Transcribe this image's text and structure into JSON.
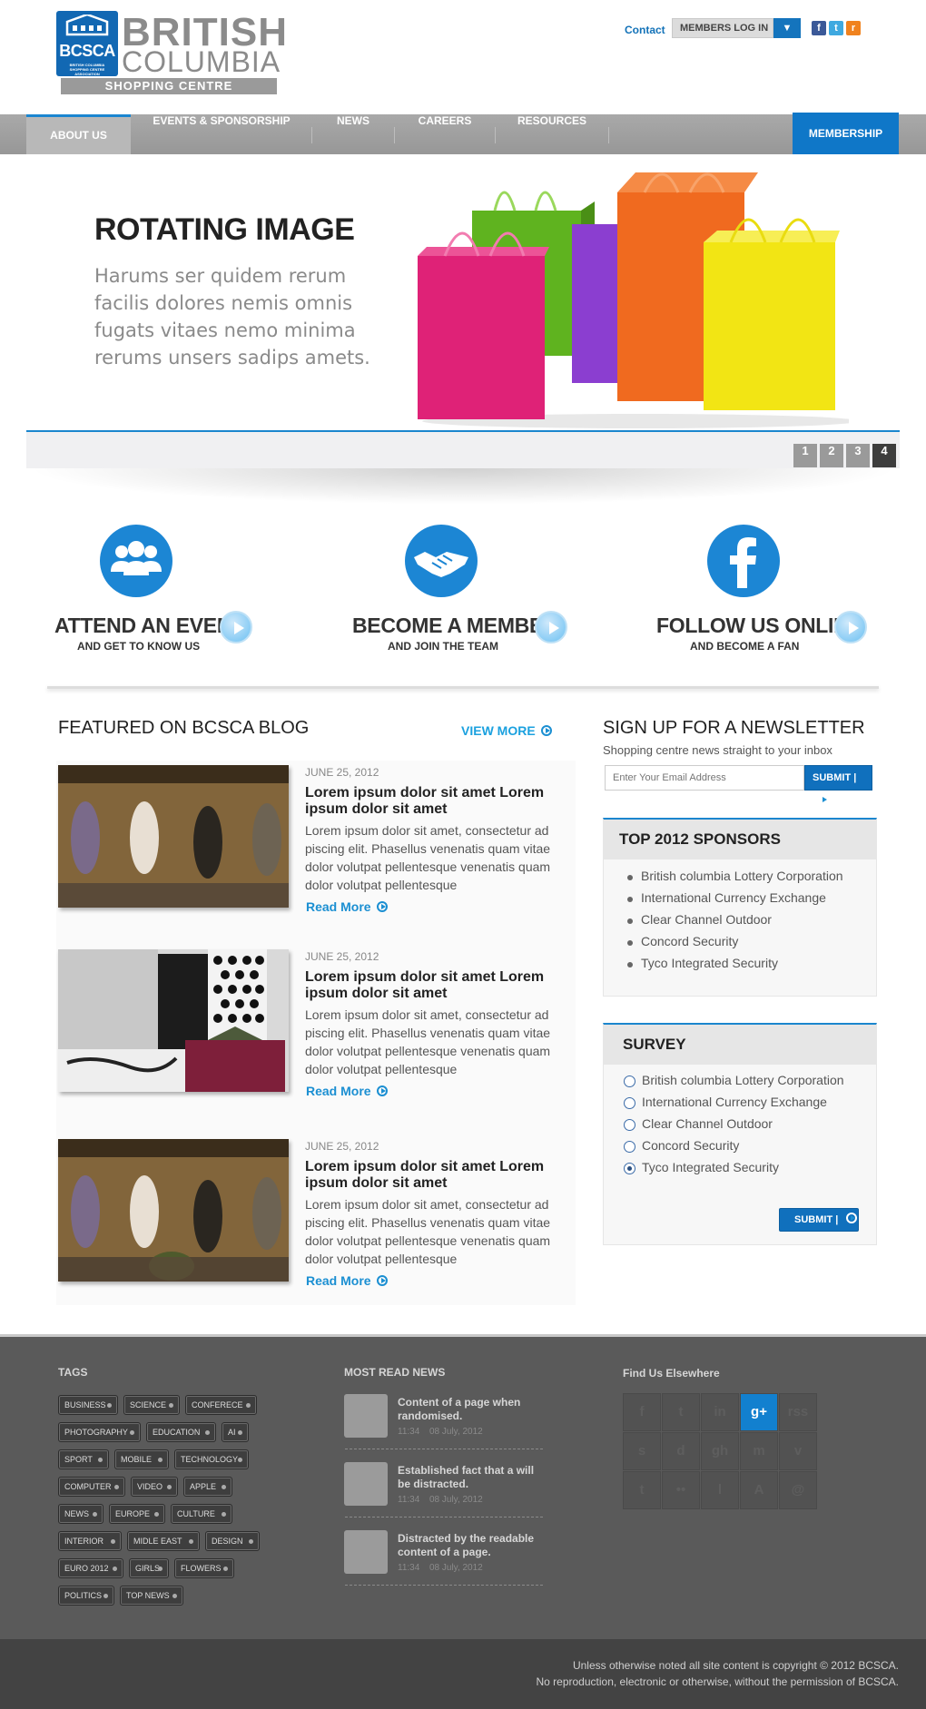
{
  "header": {
    "logo_abbr": "BCSCA",
    "logo_tiny": "BRITISH COLUMBIA SHOPPING CENTRE ASSOCIATION",
    "logo_line1": "BRITISH",
    "logo_line2": "COLUMBIA",
    "logo_tagline": "SHOPPING CENTRE ASSOCIATION",
    "contact": "Contact",
    "members_login": "MEMBERS LOG IN",
    "social": [
      {
        "icon": "facebook-icon",
        "glyph": "f",
        "color": "#3b5998"
      },
      {
        "icon": "twitter-icon",
        "glyph": "t",
        "color": "#3fa9e0"
      },
      {
        "icon": "rss-icon",
        "glyph": "r",
        "color": "#f0821e"
      }
    ]
  },
  "nav": {
    "items": [
      "ABOUT US",
      "EVENTS & SPONSORSHIP",
      "NEWS",
      "CAREERS",
      "RESOURCES"
    ],
    "membership": "MEMBERSHIP"
  },
  "hero": {
    "title": "ROTATING IMAGE",
    "text": "Harums ser quidem rerum facilis dolores nemis omnis fugats vitaes nemo minima rerums unsers sadips amets.",
    "pages": [
      "1",
      "2",
      "3",
      "4"
    ],
    "active_page": "4",
    "bag_colors": [
      "#e0237a",
      "#6cc22a",
      "#8a3fc8",
      "#f06a1f",
      "#f2e514"
    ]
  },
  "features": [
    {
      "icon": "people-icon",
      "title": "ATTEND AN EVENT",
      "subtitle": "AND GET TO KNOW US"
    },
    {
      "icon": "handshake-icon",
      "title": "BECOME A MEMBER",
      "subtitle": "AND JOIN THE TEAM"
    },
    {
      "icon": "facebook-icon",
      "title": "FOLLOW US ONLINE",
      "subtitle": "AND BECOME A FAN"
    }
  ],
  "blog": {
    "heading": "FEATURED ON BCSCA BLOG",
    "view_more": "VIEW MORE",
    "posts": [
      {
        "date": "JUNE 25, 2012",
        "title": "Lorem ipsum dolor sit amet Lorem ipsum dolor sit amet",
        "body": "Lorem ipsum dolor sit amet, consectetur ad piscing elit. Phasellus venenatis quam vitae dolor volutpat pellentesque venenatis quam dolor volutpat pellentesque",
        "read_more": "Read More"
      },
      {
        "date": "JUNE 25, 2012",
        "title": "Lorem ipsum dolor sit amet Lorem ipsum dolor sit amet",
        "body": "Lorem ipsum dolor sit amet, consectetur ad piscing elit. Phasellus venenatis quam vitae dolor volutpat pellentesque venenatis quam dolor volutpat pellentesque",
        "read_more": "Read More"
      },
      {
        "date": "JUNE 25, 2012",
        "title": "Lorem ipsum dolor sit amet Lorem ipsum dolor sit amet",
        "body": "Lorem ipsum dolor sit amet, consectetur ad piscing elit. Phasellus venenatis quam vitae dolor volutpat pellentesque venenatis quam dolor volutpat pellentesque",
        "read_more": "Read More"
      }
    ]
  },
  "newsletter": {
    "heading": "SIGN UP FOR A NEWSLETTER",
    "subtitle": "Shopping centre news straight to your inbox",
    "placeholder": "Enter Your Email Address",
    "submit": "SUBMIT"
  },
  "sponsors": {
    "heading": "TOP 2012 SPONSORS",
    "items": [
      "British columbia Lottery Corporation",
      "International Currency Exchange",
      "Clear Channel Outdoor",
      "Concord Security",
      "Tyco Integrated Security"
    ]
  },
  "survey": {
    "heading": "SURVEY",
    "options": [
      "British columbia Lottery Corporation",
      "International Currency Exchange",
      "Clear Channel Outdoor",
      "Concord Security",
      "Tyco Integrated Security"
    ],
    "selected": "Tyco Integrated Security",
    "submit": "SUBMIT"
  },
  "footer": {
    "tags_heading": "TAGS",
    "tags": [
      [
        "BUSINESS",
        "SCIENCE",
        "CONFERECE"
      ],
      [
        "PHOTOGRAPHY",
        "EDUCATION",
        "AI"
      ],
      [
        "SPORT",
        "MOBILE",
        "TECHNOLOGY"
      ],
      [
        "COMPUTER",
        "VIDEO",
        "APPLE"
      ],
      [
        "NEWS",
        "EUROPE",
        "CULTURE"
      ],
      [
        "INTERIOR",
        "MIDLE EAST",
        "DESIGN"
      ],
      [
        "EURO 2012",
        "GIRLS",
        "FLOWERS"
      ],
      [
        "POLITICS",
        "TOP NEWS"
      ]
    ],
    "news_heading": "MOST READ NEWS",
    "news": [
      {
        "title": "Content of a page when randomised.",
        "time": "11:34",
        "date": "08 July, 2012"
      },
      {
        "title": "Established fact that a will be distracted.",
        "time": "11:34",
        "date": "08 July, 2012"
      },
      {
        "title": "Distracted by the readable content of a page.",
        "time": "11:34",
        "date": "08 July, 2012"
      }
    ],
    "elsewhere_heading": "Find Us Elsewhere",
    "elsewhere_icons": [
      {
        "icon": "facebook-icon",
        "glyph": "f"
      },
      {
        "icon": "twitter-icon",
        "glyph": "t"
      },
      {
        "icon": "linkedin-icon",
        "glyph": "in"
      },
      {
        "icon": "google-plus-icon",
        "glyph": "g+"
      },
      {
        "icon": "rss-icon",
        "glyph": "rss"
      },
      {
        "icon": "skype-icon",
        "glyph": "s"
      },
      {
        "icon": "dribbble-icon",
        "glyph": "d"
      },
      {
        "icon": "github-icon",
        "glyph": "gh"
      },
      {
        "icon": "myspace-icon",
        "glyph": "m"
      },
      {
        "icon": "vimeo-icon",
        "glyph": "v"
      },
      {
        "icon": "tumblr-icon",
        "glyph": "t"
      },
      {
        "icon": "flickr-icon",
        "glyph": "••"
      },
      {
        "icon": "leaf-icon",
        "glyph": "l"
      },
      {
        "icon": "appstore-icon",
        "glyph": "A"
      },
      {
        "icon": "email-icon",
        "glyph": "@"
      }
    ],
    "elsewhere_active": "google-plus-icon",
    "copyright_line1": "Unless otherwise noted all site content is copyright © 2012 BCSCA.",
    "copyright_line2": "No reproduction, electronic or otherwise, without the permission of BCSCA."
  }
}
